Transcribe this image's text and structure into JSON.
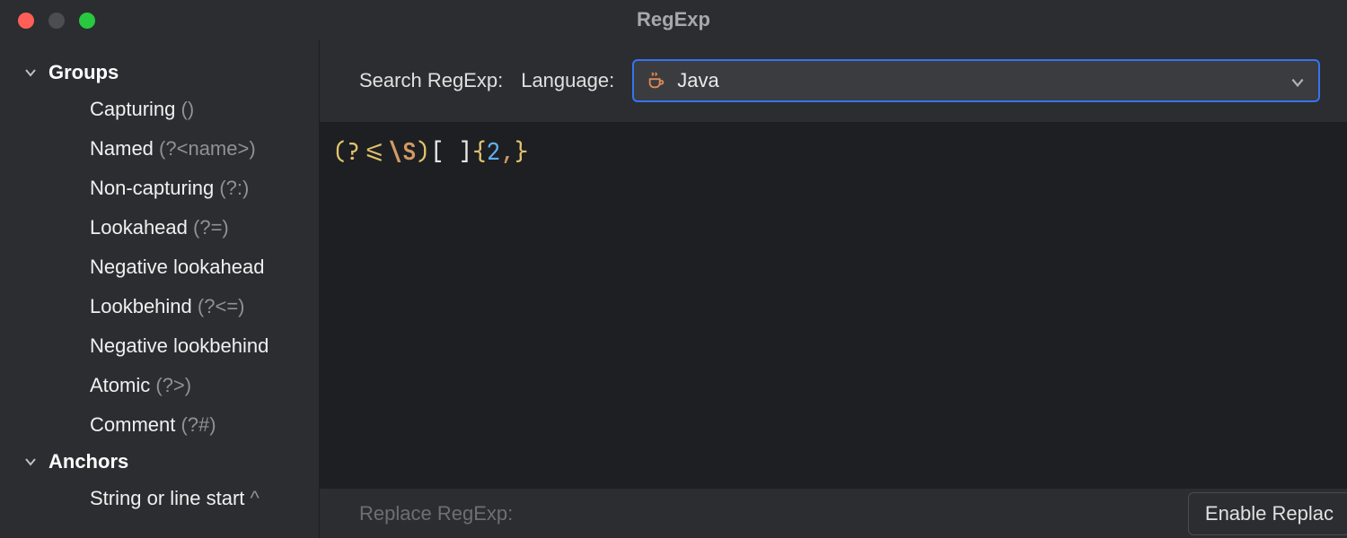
{
  "window": {
    "title": "RegExp"
  },
  "sidebar": {
    "sections": [
      {
        "title": "Groups",
        "expanded": true,
        "items": [
          {
            "label": "Capturing",
            "hint": "()"
          },
          {
            "label": "Named",
            "hint": "(?<name>)"
          },
          {
            "label": "Non-capturing",
            "hint": "(?:)"
          },
          {
            "label": "Lookahead",
            "hint": "(?=)"
          },
          {
            "label": "Negative lookahead",
            "hint": ""
          },
          {
            "label": "Lookbehind",
            "hint": "(?<=)"
          },
          {
            "label": "Negative lookbehind",
            "hint": ""
          },
          {
            "label": "Atomic",
            "hint": "(?>)"
          },
          {
            "label": "Comment",
            "hint": "(?#)"
          }
        ]
      },
      {
        "title": "Anchors",
        "expanded": true,
        "items": [
          {
            "label": "String or line start",
            "hint": "^"
          }
        ]
      }
    ]
  },
  "toolbar": {
    "search_label": "Search RegExp:",
    "language_label": "Language:",
    "language_value": "Java"
  },
  "editor": {
    "regex_raw": "(?<=\\S)[ ]{2,}",
    "tokens": {
      "open": "(?<=",
      "esc": "\\S",
      "close": ")",
      "charclass": "[ ]",
      "brace_open": "{",
      "num": "2",
      "comma": ",",
      "brace_close": "}"
    }
  },
  "replace": {
    "label": "Replace RegExp:",
    "button": "Enable Replac"
  }
}
